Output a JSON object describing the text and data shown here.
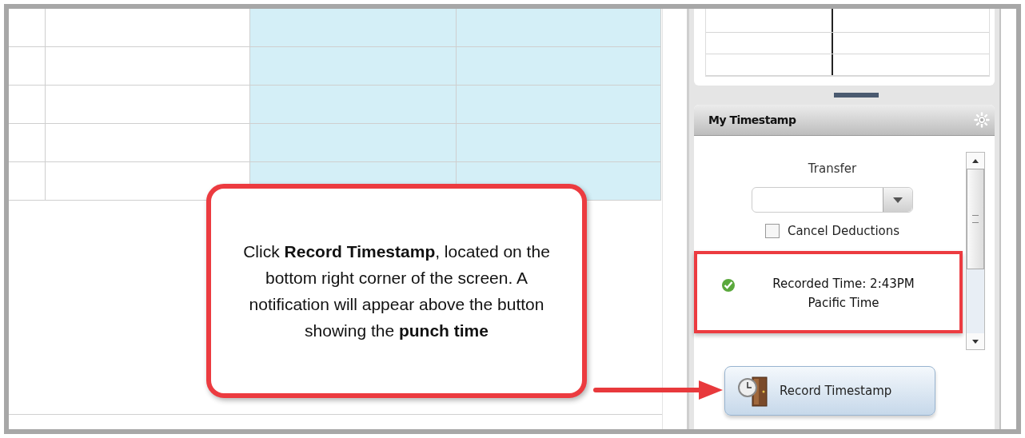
{
  "grid": {
    "columns": [
      {
        "highlighted": false
      },
      {
        "highlighted": false
      },
      {
        "highlighted": true
      },
      {
        "highlighted": true
      }
    ]
  },
  "timestamp_panel": {
    "title": "My Timestamp",
    "transfer_label": "Transfer",
    "cancel_deductions": {
      "label": "Cancel Deductions",
      "checked": false
    },
    "notification": {
      "lines": [
        "Recorded Time: 2:43PM",
        "Pacific Time"
      ],
      "highlighted": true
    },
    "button": "Record Timestamp"
  },
  "callout": {
    "text": "Click **Record Timestamp**, located on the bottom right corner of the screen. A notification will appear above the button showing the **punch time**"
  }
}
